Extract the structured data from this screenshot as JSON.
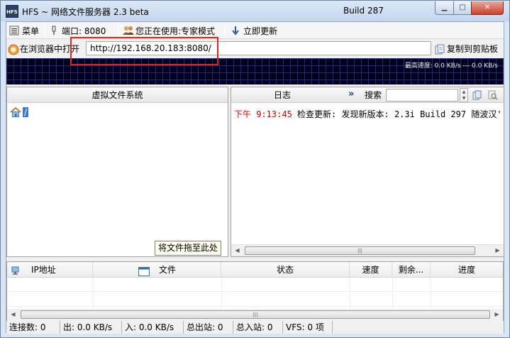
{
  "window": {
    "app_icon_text": "HFS",
    "title": "HFS ~ 网络文件服务器 2.3 beta",
    "build": "Build 287",
    "min_glyph": "▁",
    "max_glyph": "□",
    "close_glyph": "✕"
  },
  "menubar": {
    "menu_label": "菜单",
    "port_label": "端口: 8080",
    "mode_label": "您正在使用:专家模式",
    "update_label": "立即更新"
  },
  "urlbar": {
    "open_in_browser_label": "在浏览器中打开",
    "url": "http://192.168.20.183:8080/",
    "copy_label": "复制到剪贴板"
  },
  "graph": {
    "label": "最高速度: 0.0 KB/s --- 0.0 KB/s"
  },
  "vfs": {
    "header": "虚拟文件系统",
    "root_label": "/",
    "drag_tip": "将文件拖至此处"
  },
  "log": {
    "header": "日志",
    "expand_glyph": "»",
    "search_label": "搜索",
    "search_value": "",
    "entries": [
      {
        "time": "下午 9:13:45",
        "text": "检查更新: 发现新版本: 2.3i Build 297 随波汉'"
      }
    ]
  },
  "connections": {
    "columns": [
      "IP地址",
      "文件",
      "状态",
      "速度",
      "剩余...",
      "进度"
    ]
  },
  "statusbar": {
    "connections": "连接数: 0",
    "out": "出: 0.0 KB/s",
    "in": "入: 0.0 KB/s",
    "total_out": "总出站: 0",
    "total_in": "总入站: 0",
    "vfs": "VFS: 0 项"
  },
  "colors": {
    "highlight_box": "#e0251f",
    "log_time": "#cc0000",
    "graph_bg": "#000018"
  }
}
